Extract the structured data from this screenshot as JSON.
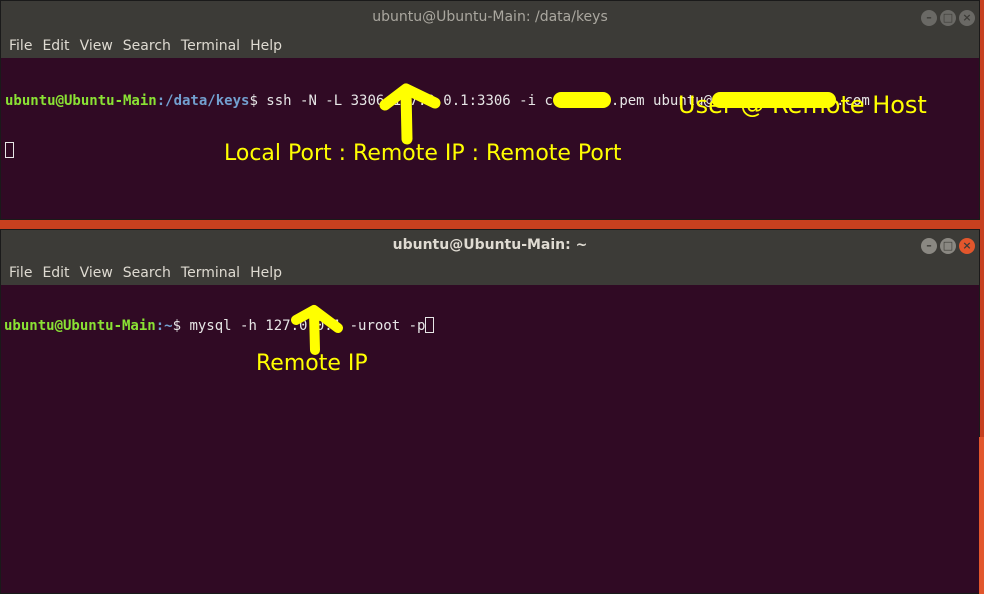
{
  "window1": {
    "title": "ubuntu@Ubuntu-Main: /data/keys",
    "menu": [
      "File",
      "Edit",
      "View",
      "Search",
      "Terminal",
      "Help"
    ],
    "prompt_user": "ubuntu@Ubuntu-Main",
    "prompt_path": ":/data/keys",
    "prompt_symbol": "$",
    "command_before": " ssh -N -L 3306:127.0.0.1:3306 -i ",
    "key_prefix": "c",
    "key_suffix": ".pem ubuntu@",
    "host_suffix": ".com"
  },
  "window2": {
    "title": "ubuntu@Ubuntu-Main: ~",
    "menu": [
      "File",
      "Edit",
      "View",
      "Search",
      "Terminal",
      "Help"
    ],
    "prompt_user": "ubuntu@Ubuntu-Main",
    "prompt_path": ":~",
    "prompt_symbol": "$",
    "command": " mysql -h 127.0.0.1 -uroot -p"
  },
  "annotations": {
    "user_remote_host": "User @ Remote Host",
    "port_mapping": "Local Port : Remote IP : Remote Port",
    "remote_ip": "Remote IP"
  },
  "colors": {
    "terminal_bg": "#300a24",
    "annotation": "#ffff00",
    "prompt_user": "#8ae234",
    "prompt_path": "#729fcf",
    "desktop": "#c7401f"
  }
}
